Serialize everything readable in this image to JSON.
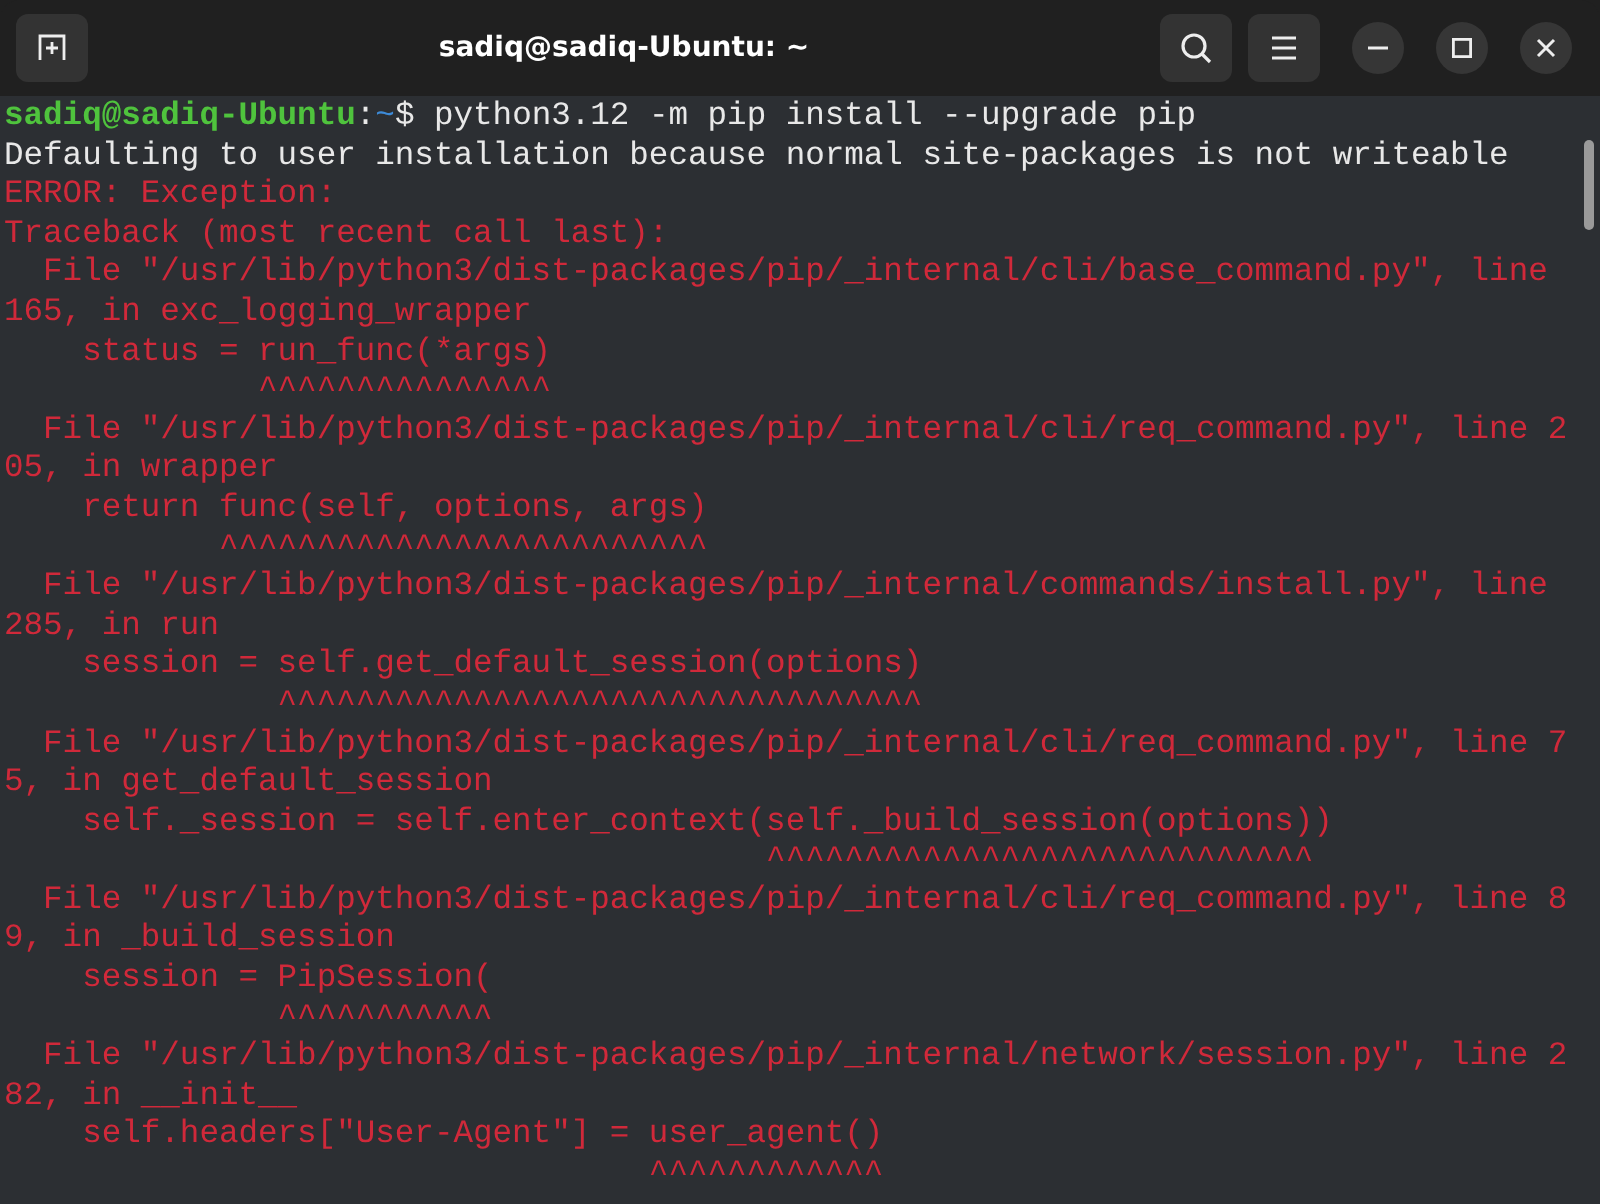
{
  "window": {
    "title": "sadiq@sadiq-Ubuntu: ~"
  },
  "terminal": {
    "lines": [
      {
        "kind": "prompt",
        "user_host": "sadiq@sadiq-Ubuntu",
        "separator": ":",
        "path": "~",
        "symbol": "$",
        "command": " python3.12 -m pip install --upgrade pip"
      },
      {
        "kind": "output",
        "text": "Defaulting to user installation because normal site-packages is not writeable"
      },
      {
        "kind": "error",
        "text": "ERROR: Exception:"
      },
      {
        "kind": "error",
        "text": "Traceback (most recent call last):"
      },
      {
        "kind": "error",
        "text": "  File \"/usr/lib/python3/dist-packages/pip/_internal/cli/base_command.py\", line"
      },
      {
        "kind": "error",
        "text": "165, in exc_logging_wrapper"
      },
      {
        "kind": "error",
        "text": "    status = run_func(*args)"
      },
      {
        "kind": "error",
        "text": "             ^^^^^^^^^^^^^^^"
      },
      {
        "kind": "error",
        "text": "  File \"/usr/lib/python3/dist-packages/pip/_internal/cli/req_command.py\", line 2"
      },
      {
        "kind": "error",
        "text": "05, in wrapper"
      },
      {
        "kind": "error",
        "text": "    return func(self, options, args)"
      },
      {
        "kind": "error",
        "text": "           ^^^^^^^^^^^^^^^^^^^^^^^^^"
      },
      {
        "kind": "error",
        "text": "  File \"/usr/lib/python3/dist-packages/pip/_internal/commands/install.py\", line"
      },
      {
        "kind": "error",
        "text": "285, in run"
      },
      {
        "kind": "error",
        "text": "    session = self.get_default_session(options)"
      },
      {
        "kind": "error",
        "text": "              ^^^^^^^^^^^^^^^^^^^^^^^^^^^^^^^^^"
      },
      {
        "kind": "error",
        "text": "  File \"/usr/lib/python3/dist-packages/pip/_internal/cli/req_command.py\", line 7"
      },
      {
        "kind": "error",
        "text": "5, in get_default_session"
      },
      {
        "kind": "error",
        "text": "    self._session = self.enter_context(self._build_session(options))"
      },
      {
        "kind": "error",
        "text": "                                       ^^^^^^^^^^^^^^^^^^^^^^^^^^^^"
      },
      {
        "kind": "error",
        "text": "  File \"/usr/lib/python3/dist-packages/pip/_internal/cli/req_command.py\", line 8"
      },
      {
        "kind": "error",
        "text": "9, in _build_session"
      },
      {
        "kind": "error",
        "text": "    session = PipSession("
      },
      {
        "kind": "error",
        "text": "              ^^^^^^^^^^^"
      },
      {
        "kind": "error",
        "text": "  File \"/usr/lib/python3/dist-packages/pip/_internal/network/session.py\", line 2"
      },
      {
        "kind": "error",
        "text": "82, in __init__"
      },
      {
        "kind": "error",
        "text": "    self.headers[\"User-Agent\"] = user_agent()"
      },
      {
        "kind": "error",
        "text": "                                 ^^^^^^^^^^^^"
      }
    ]
  }
}
